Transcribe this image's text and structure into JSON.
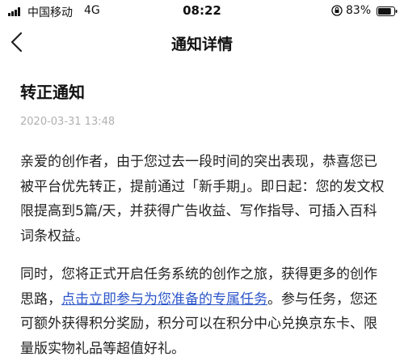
{
  "status_bar": {
    "carrier": "中国移动",
    "network": "4G",
    "time": "08:22",
    "battery": "83%",
    "battery_level": 0.83
  },
  "nav": {
    "title": "通知详情",
    "back_icon": "chevron-left-icon"
  },
  "notice": {
    "title": "转正通知",
    "date": "2020-03-31 13:48",
    "paragraph1": "亲爱的创作者，由于您过去一段时间的突出表现，恭喜您已被平台优先转正，提前通过「新手期」。即日起：您的发文权限提高到5篇/天，并获得广告收益、写作指导、可插入百科词条权益。",
    "paragraph2_before": "同时，您将正式开启任务系统的创作之旅，获得更多的创作思路，",
    "paragraph2_link": "点击立即参与为您准备的专属任务",
    "paragraph2_after": "。参与任务，您还可额外获得积分奖励，积分可以在积分中心兑换京东卡、限量版实物礼品等超值好礼。"
  },
  "colors": {
    "link": "#2b55c9",
    "date": "#b0b0b0",
    "text": "#222222"
  }
}
